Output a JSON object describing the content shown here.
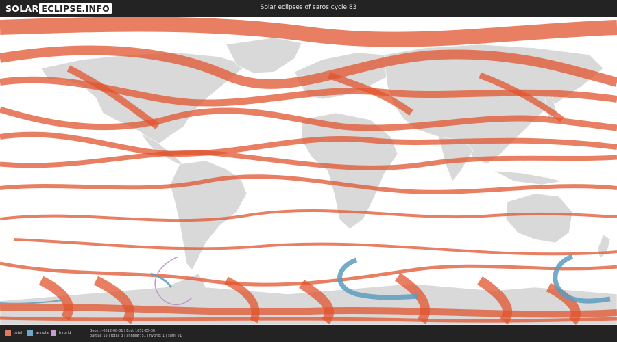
{
  "header": {
    "logo_part1": "SOLAR",
    "logo_part2": "ECLIPSE.INFO",
    "title": "Solar eclipses of saros cycle 83"
  },
  "legend": [
    {
      "label": "total",
      "color": "#e07a5f"
    },
    {
      "label": "annular",
      "color": "#6fa8c8"
    },
    {
      "label": "hybrid",
      "color": "#c89ad0"
    }
  ],
  "info": {
    "line1": "Begin: -0012-08-31 | End: 1052-05-30",
    "line2": "partial: 16 | total: 3 | annular: 51 | hybrid: 1 | sum: 71"
  },
  "colors": {
    "total_path": "#e0542e",
    "annular_path": "#5b9cbf",
    "hybrid_path": "#b48ac4",
    "land": "#d9d9d9",
    "ocean": "#ffffff",
    "header_bg": "#232323"
  }
}
